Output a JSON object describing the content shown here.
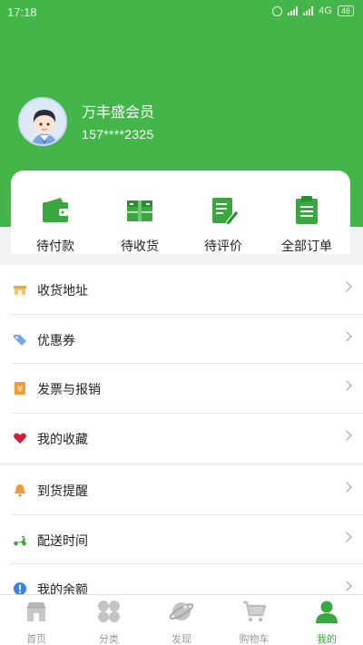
{
  "status_bar": {
    "time": "17:18",
    "network": "4G",
    "battery": "46"
  },
  "profile": {
    "name": "万丰盛会员",
    "phone": "157****2325"
  },
  "orders": [
    {
      "label": "待付款",
      "icon": "wallet-icon"
    },
    {
      "label": "待收货",
      "icon": "package-icon"
    },
    {
      "label": "待评价",
      "icon": "edit-review-icon"
    },
    {
      "label": "全部订单",
      "icon": "clipboard-icon"
    }
  ],
  "menu_group_1": [
    {
      "label": "收货地址",
      "icon": "address-icon"
    },
    {
      "label": "优惠券",
      "icon": "coupon-tag-icon"
    },
    {
      "label": "发票与报销",
      "icon": "invoice-yen-icon"
    },
    {
      "label": "我的收藏",
      "icon": "heart-icon"
    }
  ],
  "menu_group_2": [
    {
      "label": "到货提醒",
      "icon": "bell-icon"
    },
    {
      "label": "配送时间",
      "icon": "scooter-icon"
    },
    {
      "label": "我的余额",
      "icon": "info-balance-icon"
    }
  ],
  "tabbar": [
    {
      "label": "首页",
      "icon": "home-shop-icon"
    },
    {
      "label": "分类",
      "icon": "category-icon"
    },
    {
      "label": "发现",
      "icon": "discover-planet-icon"
    },
    {
      "label": "购物车",
      "icon": "cart-icon"
    },
    {
      "label": "我的",
      "icon": "user-icon",
      "active": true
    }
  ],
  "colors": {
    "brand_green": "#44b549",
    "active_tab": "#3aa63f",
    "tab_inactive": "#999999"
  }
}
